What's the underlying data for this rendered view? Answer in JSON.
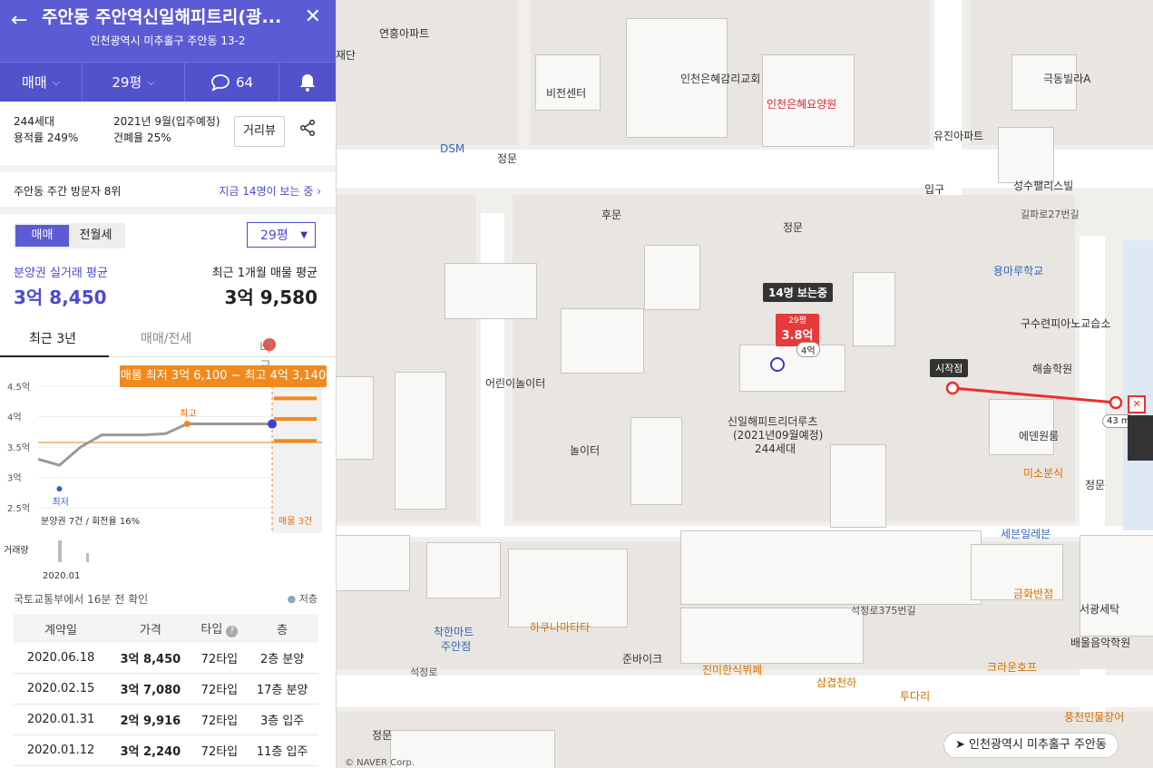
{
  "header": {
    "back_icon": "←",
    "title": "주안동 주안역신일해피트리(광...",
    "close_icon": "✕",
    "address": "인천광역시 미추홀구 주안동 13-2"
  },
  "segment": {
    "trade": "매매",
    "pyeong": "29평",
    "comments": "64"
  },
  "info": {
    "households": "244세대",
    "floor_area_ratio": "용적률 249%",
    "move_in": "2021년 9월(입주예정)",
    "coverage": "건폐율 25%",
    "distance_view": "거리뷰"
  },
  "visitors": {
    "rank": "주안동 주간 방문자 8위",
    "now": "지금 14명이 보는 중"
  },
  "price": {
    "tab_trade": "매매",
    "tab_rent": "전월세",
    "pyeong": "29평",
    "presale_label": "분양권 실거래 평균",
    "presale_value": "3억 8,450",
    "listing_label": "최근 1개월 매물 평균",
    "listing_value": "3억 9,580"
  },
  "tabs": {
    "t1": "최근 3년",
    "t2": "매매/전세",
    "t3": "비교",
    "badge": "N"
  },
  "chart_badge": "매물 최저 3억 6,100 ~ 최고 4억 3,140",
  "chart_data": {
    "type": "line",
    "y_ticks": [
      "4.5억",
      "4억",
      "3.5억",
      "3억",
      "2.5억"
    ],
    "ylim": [
      2.5,
      4.5
    ],
    "x_labels": [
      "2020.01"
    ],
    "series": [
      {
        "values": [
          3.3,
          3.2,
          3.5,
          3.7,
          3.7,
          3.7,
          3.72,
          3.88,
          3.88,
          3.88,
          3.88,
          3.88
        ]
      }
    ],
    "listing_levels": [
      4.3,
      3.96,
      3.6
    ],
    "low_label": "최저",
    "high_label": "최고",
    "footer_left": "분양권 7건 / 회전율 16%",
    "footer_right": "매물 3건",
    "volume_label": "거래량"
  },
  "table": {
    "note": "국토교통부에서 16분 전 확인",
    "legend": "저층",
    "headers": [
      "계약일",
      "가격",
      "타입",
      "층"
    ],
    "rows": [
      [
        "2020.06.18",
        "3억 8,450",
        "72타입",
        "2층 분양"
      ],
      [
        "2020.02.15",
        "3억 7,080",
        "72타입",
        "17층 분양"
      ],
      [
        "2020.01.31",
        "2억 9,916",
        "72타입",
        "3층 입주"
      ],
      [
        "2020.01.12",
        "3억 2,240",
        "72타입",
        "11층 입주"
      ]
    ]
  },
  "map": {
    "labels": [
      "연흥아파트",
      "인천은혜감리교회",
      "인천은혜요양원",
      "비전센터",
      "유진아파트",
      "극동빌라A",
      "성수팰리스빌",
      "길파로27번길",
      "용마루학교",
      "구수련피아노교습소",
      "해솔학원",
      "에덴원룸",
      "미소분식",
      "세븐일레븐",
      "신일해피트리더루츠",
      "(2021년09월예정)",
      "244세대",
      "어린이놀이터",
      "놀이터",
      "착한마트",
      "주안점",
      "하쿠나마타타",
      "준바이크",
      "진미한식뷔페",
      "삼겹천하",
      "투다리",
      "크라운호프",
      "금화반점",
      "서광세탁",
      "배울음악학원",
      "풍천민물장어",
      "석정로",
      "석정로375번길",
      "DSM",
      "정문",
      "후문",
      "입구",
      "재단"
    ],
    "pin": {
      "viewers": "14명 보는중",
      "py": "29평",
      "price": "3.8억",
      "alt": "4억"
    },
    "route": {
      "start": "시작점",
      "dist": "43 m"
    },
    "status": "인천광역시 미추홀구 주안동",
    "copyright": "© NAVER Corp."
  }
}
